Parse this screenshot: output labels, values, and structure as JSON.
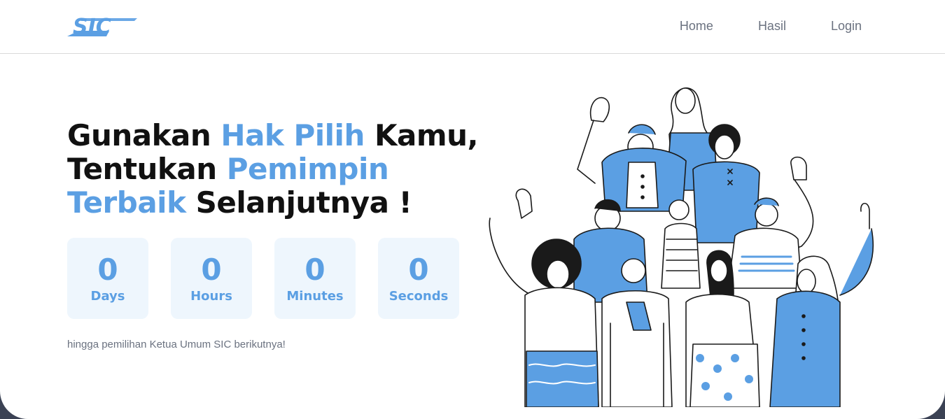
{
  "brand": {
    "logo_text": "SIC",
    "color": "#5b9fe3"
  },
  "nav": {
    "links": [
      "Home",
      "Hasil",
      "Login"
    ]
  },
  "hero": {
    "line1_a": "Gunakan ",
    "line1_accent": "Hak Pilih",
    "line1_b": " Kamu,",
    "line2_a": "Tentukan ",
    "line2_accent": "Pemimpin",
    "line3_accent": "Terbaik",
    "line3_b": " Selanjutnya !"
  },
  "countdown": [
    {
      "value": "0",
      "label": "Days"
    },
    {
      "value": "0",
      "label": "Hours"
    },
    {
      "value": "0",
      "label": "Minutes"
    },
    {
      "value": "0",
      "label": "Seconds"
    }
  ],
  "subtitle": "hingga pemilihan Ketua Umum SIC berikutnya!",
  "colors": {
    "accent": "#5b9fe3",
    "countdown_bg": "#eef6fd",
    "outer_bg": "#3b4254"
  }
}
